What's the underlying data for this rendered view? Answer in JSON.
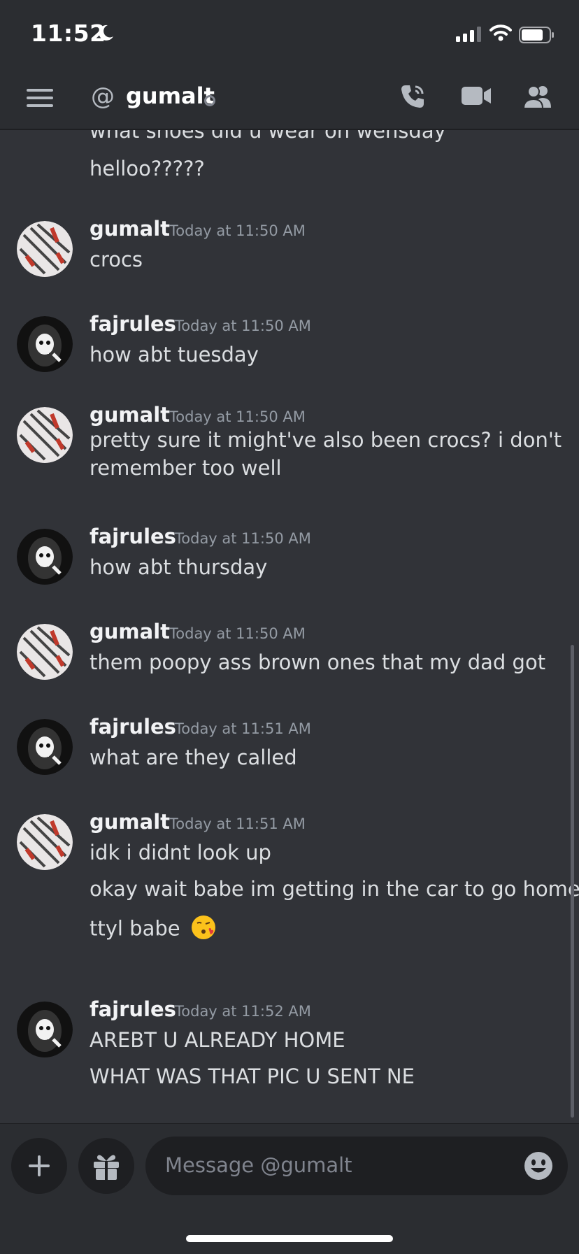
{
  "status_bar": {
    "time": "11:52"
  },
  "header": {
    "at_symbol": "@",
    "username": "gumalt"
  },
  "messages": {
    "top_lines": [
      "what shoes did u wear on wensday",
      "helloo?????"
    ],
    "groups": [
      {
        "author": "gumalt",
        "timestamp": "Today at 11:50 AM",
        "lines": [
          "crocs"
        ]
      },
      {
        "author": "fajrules",
        "timestamp": "Today at 11:50 AM",
        "lines": [
          "how abt tuesday"
        ]
      },
      {
        "author": "gumalt",
        "timestamp": "Today at 11:50 AM",
        "lines": [
          "pretty sure it might've also been crocs? i don't",
          "remember too well"
        ]
      },
      {
        "author": "fajrules",
        "timestamp": "Today at 11:50 AM",
        "lines": [
          "how abt thursday"
        ]
      },
      {
        "author": "gumalt",
        "timestamp": "Today at 11:50 AM",
        "lines": [
          "them poopy ass brown ones that my dad got"
        ]
      },
      {
        "author": "fajrules",
        "timestamp": "Today at 11:51 AM",
        "lines": [
          "what are they called"
        ]
      },
      {
        "author": "gumalt",
        "timestamp": "Today at 11:51 AM",
        "lines": [
          "idk i didnt look up",
          "okay wait babe im getting in the car to go home",
          "ttyl babe"
        ]
      },
      {
        "author": "fajrules",
        "timestamp": "Today at 11:52 AM",
        "lines": [
          "AREBT U ALREADY HOME",
          "WHAT WAS THAT PIC U SENT NE"
        ]
      }
    ]
  },
  "composer": {
    "placeholder": "Message @gumalt"
  },
  "icons": [
    "moon-icon",
    "signal-icon",
    "wifi-icon",
    "battery-icon",
    "menu-icon",
    "call-icon",
    "video-icon",
    "members-icon",
    "plus-icon",
    "gift-icon",
    "emoji-icon",
    "kiss-emoji"
  ]
}
